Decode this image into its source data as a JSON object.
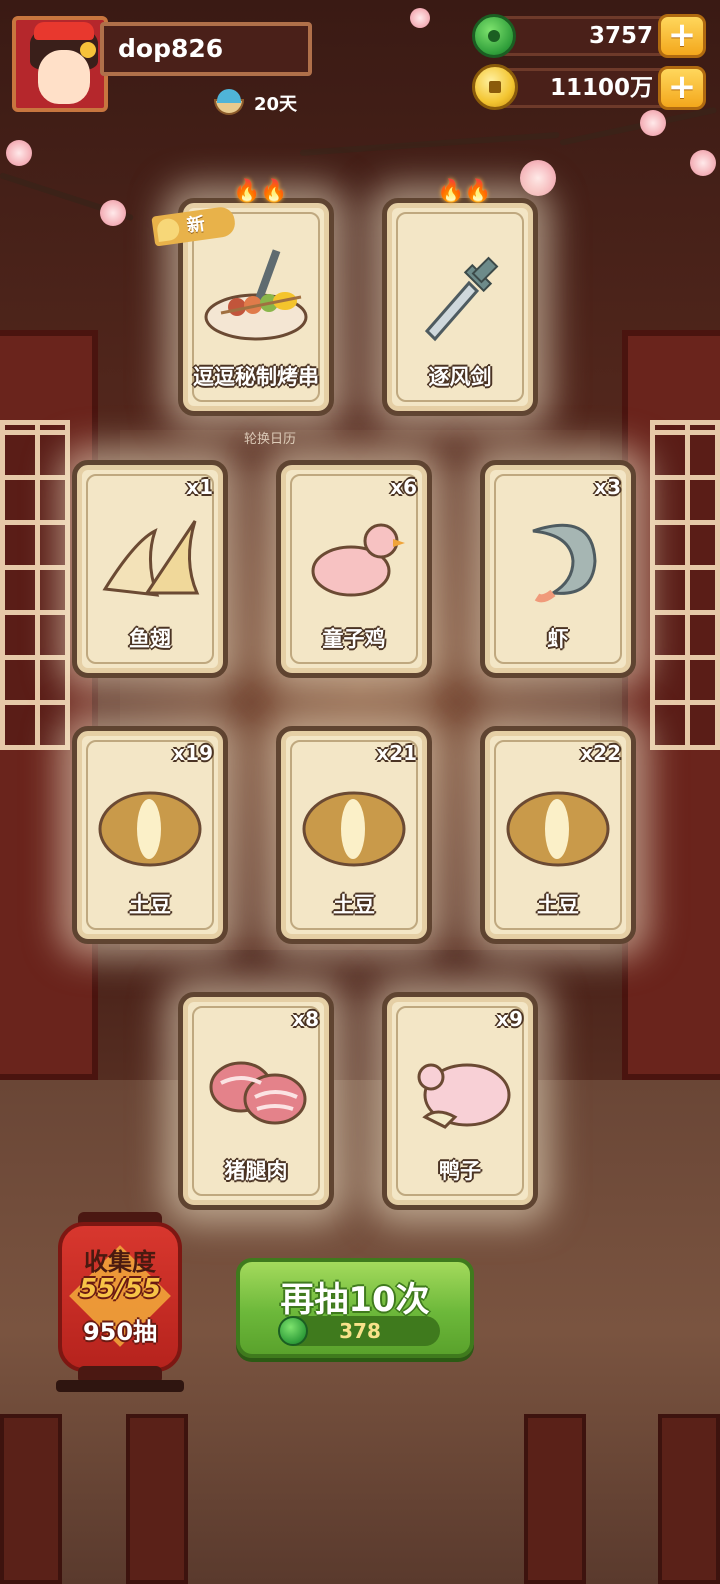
{
  "player": {
    "name": "dop826",
    "days": "20天"
  },
  "currency": {
    "jade": "3757",
    "gold": "11100万"
  },
  "featured_cards": [
    {
      "name": "逗逗秘制烤串",
      "badge": "新"
    },
    {
      "name": "逐风剑"
    }
  ],
  "calendar_label": "轮换日历",
  "draw_cards": [
    {
      "name": "鱼翅",
      "qty": "x1"
    },
    {
      "name": "童子鸡",
      "qty": "x6"
    },
    {
      "name": "虾",
      "qty": "x3"
    },
    {
      "name": "土豆",
      "qty": "x19"
    },
    {
      "name": "土豆",
      "qty": "x21"
    },
    {
      "name": "土豆",
      "qty": "x22"
    },
    {
      "name": "猪腿肉",
      "qty": "x8"
    },
    {
      "name": "鸭子",
      "qty": "x9"
    }
  ],
  "collection": {
    "title": "收集度",
    "count": "55/55",
    "draws": "950抽"
  },
  "draw_again": {
    "label": "再抽10次",
    "cost": "378"
  },
  "colors": {
    "card_bg": "#f3e6c6",
    "card_border": "#5f4431",
    "button_green": "#6cb83a",
    "lantern_red": "#c62a22"
  }
}
